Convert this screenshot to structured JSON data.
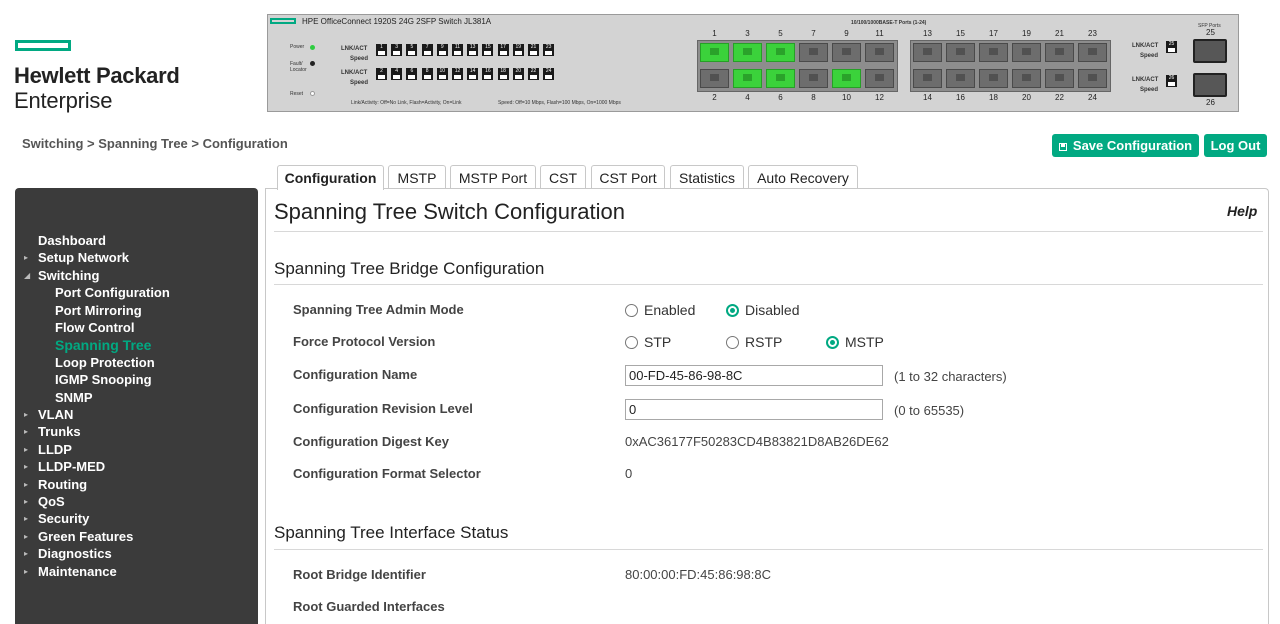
{
  "logo": {
    "line1": "Hewlett Packard",
    "line2": "Enterprise"
  },
  "faceplate": {
    "model": "HPE OfficeConnect 1920S 24G 2SFP Switch JL381A",
    "ports_header": "10/100/1000BASE-T Ports (1-24)",
    "sfp_label": "SFP Ports",
    "led_power": "Power",
    "led_fault": "Fault/ Locator",
    "led_reset": "Reset",
    "lnk_act": "LNK/ACT",
    "speed": "Speed",
    "legend_link": "Link/Activity: Off=No Link, Flash=Activity, On=Link",
    "legend_speed": "Speed: Off=10 Mbps, Flash=100 Mbps, On=1000 Mbps",
    "mini_top": [
      "1",
      "3",
      "5",
      "7",
      "9",
      "11",
      "13",
      "15",
      "17",
      "19",
      "21",
      "23"
    ],
    "mini_bottom": [
      "2",
      "4",
      "6",
      "8",
      "10",
      "12",
      "14",
      "16",
      "18",
      "20",
      "22",
      "24"
    ],
    "port_top_numbers": [
      "1",
      "3",
      "5",
      "7",
      "9",
      "11",
      "13",
      "15",
      "17",
      "19",
      "21",
      "23"
    ],
    "port_bottom_numbers": [
      "2",
      "4",
      "6",
      "8",
      "10",
      "12",
      "14",
      "16",
      "18",
      "20",
      "22",
      "24"
    ],
    "port_top_link": [
      true,
      true,
      true,
      false,
      false,
      false,
      false,
      false,
      false,
      false,
      false,
      false
    ],
    "port_bottom_link": [
      false,
      true,
      true,
      false,
      true,
      false,
      false,
      false,
      false,
      false,
      false,
      false
    ],
    "sfp_25": "25",
    "sfp_26": "26",
    "colors": {
      "link_on": "#3bd23b",
      "link_off": "#6d6d6d"
    }
  },
  "breadcrumb": "Switching > Spanning Tree > Configuration",
  "header_buttons": {
    "save": "Save Configuration",
    "logout": "Log Out"
  },
  "icons": {
    "save": "floppy-disk-icon"
  },
  "sidebar": {
    "items": [
      {
        "label": "Dashboard",
        "expander": ""
      },
      {
        "label": "Setup Network",
        "expander": "▸"
      },
      {
        "label": "Switching",
        "expander": "◢"
      },
      {
        "label": "Port Configuration",
        "expander": ""
      },
      {
        "label": "Port Mirroring",
        "expander": ""
      },
      {
        "label": "Flow Control",
        "expander": ""
      },
      {
        "label": "Spanning Tree",
        "expander": ""
      },
      {
        "label": "Loop Protection",
        "expander": ""
      },
      {
        "label": "IGMP Snooping",
        "expander": ""
      },
      {
        "label": "SNMP",
        "expander": ""
      },
      {
        "label": "VLAN",
        "expander": "▸"
      },
      {
        "label": "Trunks",
        "expander": "▸"
      },
      {
        "label": "LLDP",
        "expander": "▸"
      },
      {
        "label": "LLDP-MED",
        "expander": "▸"
      },
      {
        "label": "Routing",
        "expander": "▸"
      },
      {
        "label": "QoS",
        "expander": "▸"
      },
      {
        "label": "Security",
        "expander": "▸"
      },
      {
        "label": "Green Features",
        "expander": "▸"
      },
      {
        "label": "Diagnostics",
        "expander": "▸"
      },
      {
        "label": "Maintenance",
        "expander": "▸"
      }
    ],
    "active": "Spanning Tree"
  },
  "tabs": [
    "Configuration",
    "MSTP",
    "MSTP Port",
    "CST",
    "CST Port",
    "Statistics",
    "Auto Recovery"
  ],
  "active_tab": "Configuration",
  "page": {
    "title": "Spanning Tree Switch Configuration",
    "help": "Help",
    "bridge_section": "Spanning Tree Bridge Configuration",
    "admin_mode": {
      "label": "Spanning Tree Admin Mode",
      "options": [
        "Enabled",
        "Disabled"
      ],
      "selected": "Disabled"
    },
    "force_protocol": {
      "label": "Force Protocol Version",
      "options": [
        "STP",
        "RSTP",
        "MSTP"
      ],
      "selected": "MSTP"
    },
    "config_name": {
      "label": "Configuration Name",
      "value": "00-FD-45-86-98-8C",
      "hint": "(1 to 32 characters)"
    },
    "revision": {
      "label": "Configuration Revision Level",
      "value": "0",
      "hint": "(0 to 65535)"
    },
    "digest": {
      "label": "Configuration Digest Key",
      "value": "0xAC36177F50283CD4B83821D8AB26DE62"
    },
    "format_selector": {
      "label": "Configuration Format Selector",
      "value": "0"
    },
    "interface_section": "Spanning Tree Interface Status",
    "root_bridge": {
      "label": "Root Bridge Identifier",
      "value": "80:00:00:FD:45:86:98:8C"
    },
    "root_guarded": {
      "label": "Root Guarded Interfaces",
      "value": ""
    }
  }
}
